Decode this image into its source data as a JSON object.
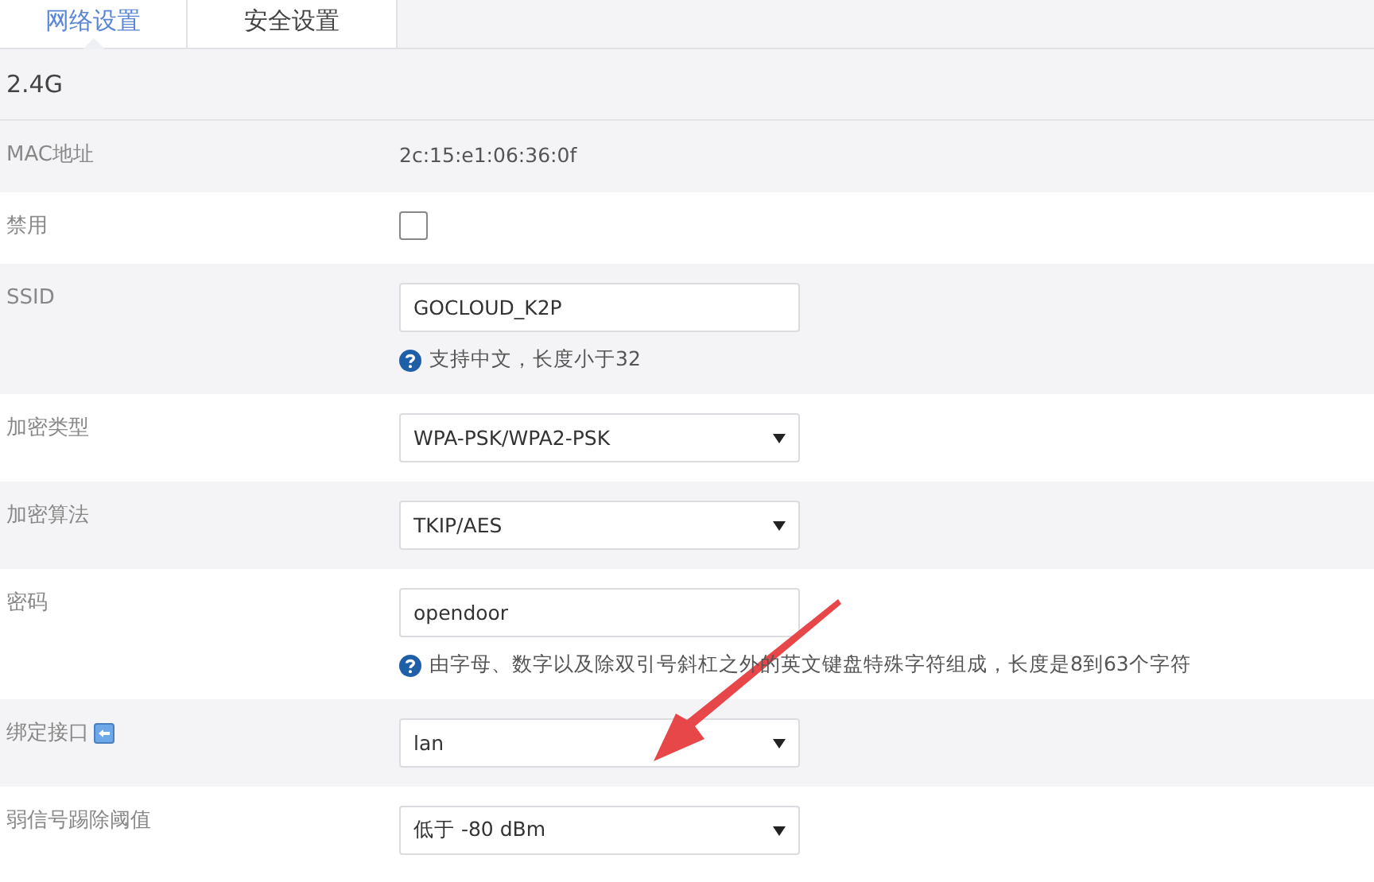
{
  "tabs": [
    {
      "label": "网络设置",
      "selected": true
    },
    {
      "label": "安全设置",
      "selected": false
    }
  ],
  "section": {
    "title": "2.4G"
  },
  "rows": [
    {
      "kind": "text",
      "label": "MAC地址",
      "value": "2c:15:e1:06:36:0f"
    },
    {
      "kind": "checkbox",
      "label": "禁用",
      "checked": false
    },
    {
      "kind": "input",
      "label": "SSID",
      "value": "GOCLOUD_K2P",
      "hint": "支持中文，长度小于32"
    },
    {
      "kind": "select",
      "label": "加密类型",
      "value": "WPA-PSK/WPA2-PSK"
    },
    {
      "kind": "select",
      "label": "加密算法",
      "value": "TKIP/AES"
    },
    {
      "kind": "input",
      "label": "密码",
      "value": "opendoor",
      "hint": "由字母、数字以及除双引号斜杠之外的英文键盘特殊字符组成，长度是8到63个字符"
    },
    {
      "kind": "select",
      "label": "绑定接口",
      "label_icon": true,
      "value": "lan"
    },
    {
      "kind": "select",
      "label": "弱信号踢除阈值",
      "value": "低于 -80 dBm"
    }
  ],
  "annotation": {
    "kind": "arrow"
  }
}
